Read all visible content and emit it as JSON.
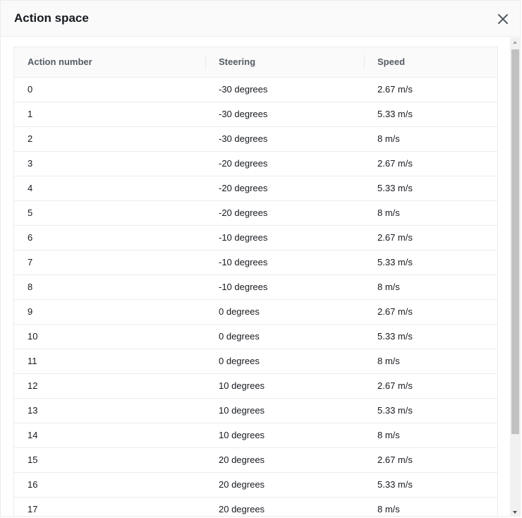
{
  "modal": {
    "title": "Action space",
    "close_icon": "close-icon"
  },
  "table": {
    "headers": [
      "Action number",
      "Steering",
      "Speed"
    ],
    "rows": [
      [
        "0",
        "-30 degrees",
        "2.67 m/s"
      ],
      [
        "1",
        "-30 degrees",
        "5.33 m/s"
      ],
      [
        "2",
        "-30 degrees",
        "8 m/s"
      ],
      [
        "3",
        "-20 degrees",
        "2.67 m/s"
      ],
      [
        "4",
        "-20 degrees",
        "5.33 m/s"
      ],
      [
        "5",
        "-20 degrees",
        "8 m/s"
      ],
      [
        "6",
        "-10 degrees",
        "2.67 m/s"
      ],
      [
        "7",
        "-10 degrees",
        "5.33 m/s"
      ],
      [
        "8",
        "-10 degrees",
        "8 m/s"
      ],
      [
        "9",
        "0 degrees",
        "2.67 m/s"
      ],
      [
        "10",
        "0 degrees",
        "5.33 m/s"
      ],
      [
        "11",
        "0 degrees",
        "8 m/s"
      ],
      [
        "12",
        "10 degrees",
        "2.67 m/s"
      ],
      [
        "13",
        "10 degrees",
        "5.33 m/s"
      ],
      [
        "14",
        "10 degrees",
        "8 m/s"
      ],
      [
        "15",
        "20 degrees",
        "2.67 m/s"
      ],
      [
        "16",
        "20 degrees",
        "5.33 m/s"
      ],
      [
        "17",
        "20 degrees",
        "8 m/s"
      ]
    ]
  },
  "colors": {
    "header_bg": "#fafafa",
    "border": "#eaeded",
    "text": "#16191f",
    "header_text": "#545b64"
  }
}
